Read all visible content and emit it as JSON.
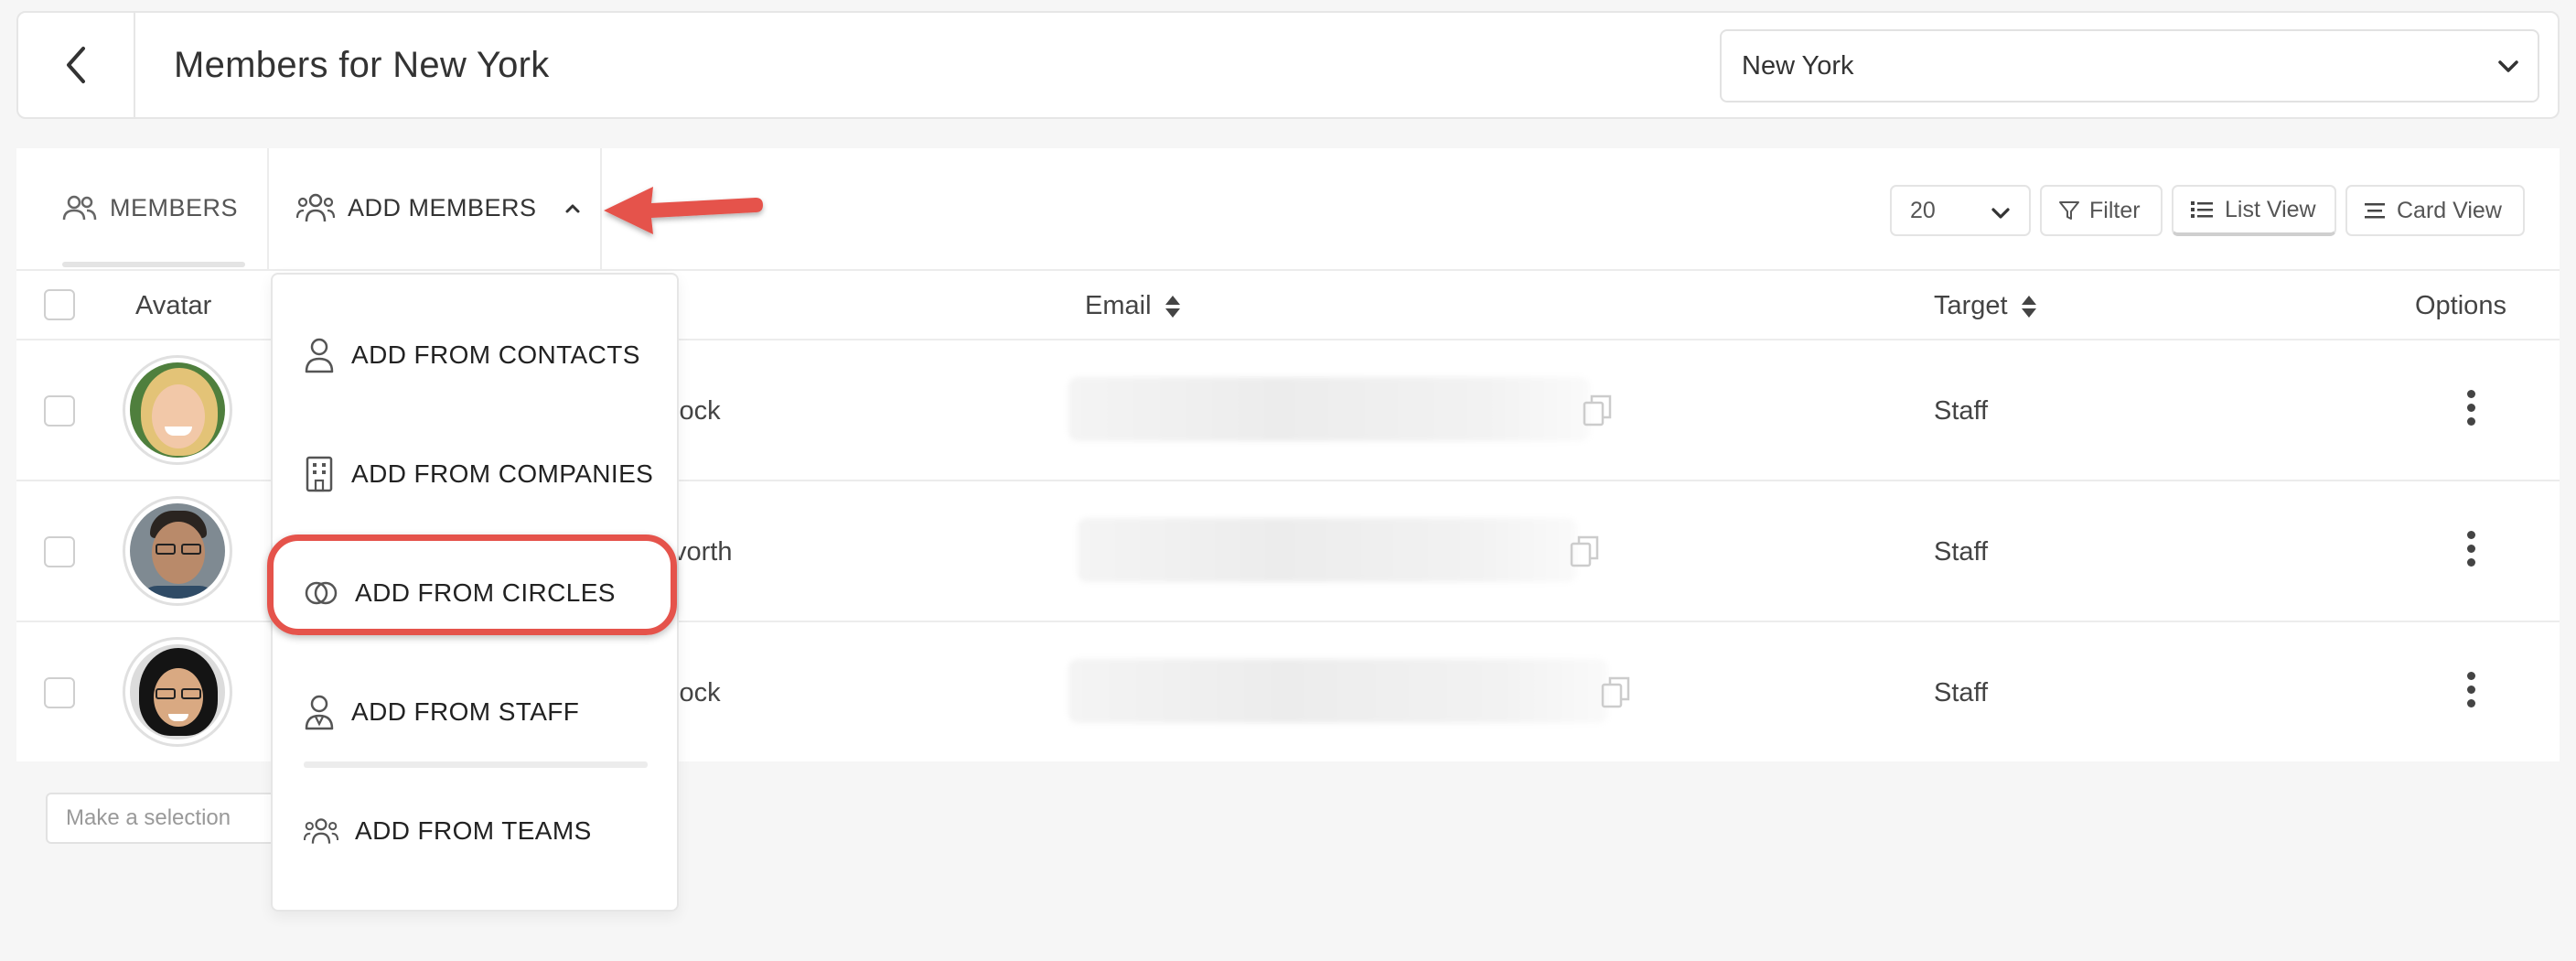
{
  "header": {
    "title": "Members for New York",
    "location_select": "New York"
  },
  "toolbar": {
    "members_tab": "MEMBERS",
    "add_members_tab": "ADD MEMBERS",
    "per_page": "20",
    "filter": "Filter",
    "list_view": "List View",
    "card_view": "Card View"
  },
  "table": {
    "columns": {
      "avatar": "Avatar",
      "email": "Email",
      "target": "Target",
      "options": "Options"
    },
    "rows": [
      {
        "name_fragment": "lock",
        "target": "Staff"
      },
      {
        "name_fragment": "vorth",
        "target": "Staff"
      },
      {
        "name_fragment": "lock",
        "target": "Staff"
      }
    ]
  },
  "footer": {
    "selection_placeholder": "Make a selection"
  },
  "add_members_menu": {
    "items": [
      {
        "label": "ADD FROM CONTACTS",
        "icon": "person-icon"
      },
      {
        "label": "ADD FROM COMPANIES",
        "icon": "building-icon"
      },
      {
        "label": "ADD FROM CIRCLES",
        "icon": "circles-icon"
      },
      {
        "label": "ADD FROM STAFF",
        "icon": "staff-icon"
      },
      {
        "label": "ADD FROM TEAMS",
        "icon": "team-icon"
      }
    ]
  },
  "annotation": {
    "accent": "#e5534b"
  }
}
